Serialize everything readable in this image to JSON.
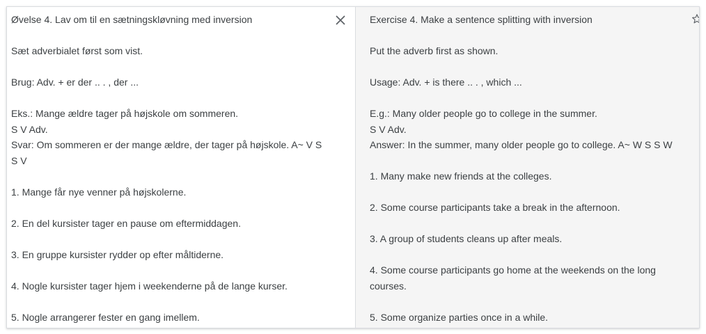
{
  "source": {
    "lines": [
      "Øvelse 4. Lav om til en sætningskløvning med inversion",
      "",
      "Sæt adverbialet først som vist.",
      "",
      "Brug: Adv. + er der .. . , der ...",
      "",
      "Eks.: Mange ældre tager på højskole om sommeren.",
      "S V Adv.",
      "Svar: Om sommeren er der mange ældre, der tager på højskole. A~ V S S V",
      "",
      "1. Mange får nye venner på højskolerne.",
      "",
      "2. En del kursister tager en pause om eftermiddagen.",
      "",
      "3. En gruppe kursister rydder op efter måltiderne.",
      "",
      "4. Nogle kursister tager hjem i weekenderne på de lange kurser.",
      "",
      "5. Nogle arrangerer fester en gang imellem."
    ],
    "close_icon": "close-icon"
  },
  "target": {
    "lines": [
      "Exercise 4. Make a sentence splitting with inversion",
      "",
      "Put the adverb first as shown.",
      "",
      "Usage: Adv. + is there .. . , which ...",
      "",
      "E.g.: Many older people go to college in the summer.",
      "S V Adv.",
      "Answer: In the summer, many older people go to college. A~ W S S W",
      "",
      "1. Many make new friends at the colleges.",
      "",
      "2. Some course participants take a break in the afternoon.",
      "",
      "3. A group of students cleans up after meals.",
      "",
      "4. Some course participants go home at the weekends on the long courses.",
      "",
      "5. Some organize parties once in a while."
    ],
    "star_icon": "star-icon"
  }
}
